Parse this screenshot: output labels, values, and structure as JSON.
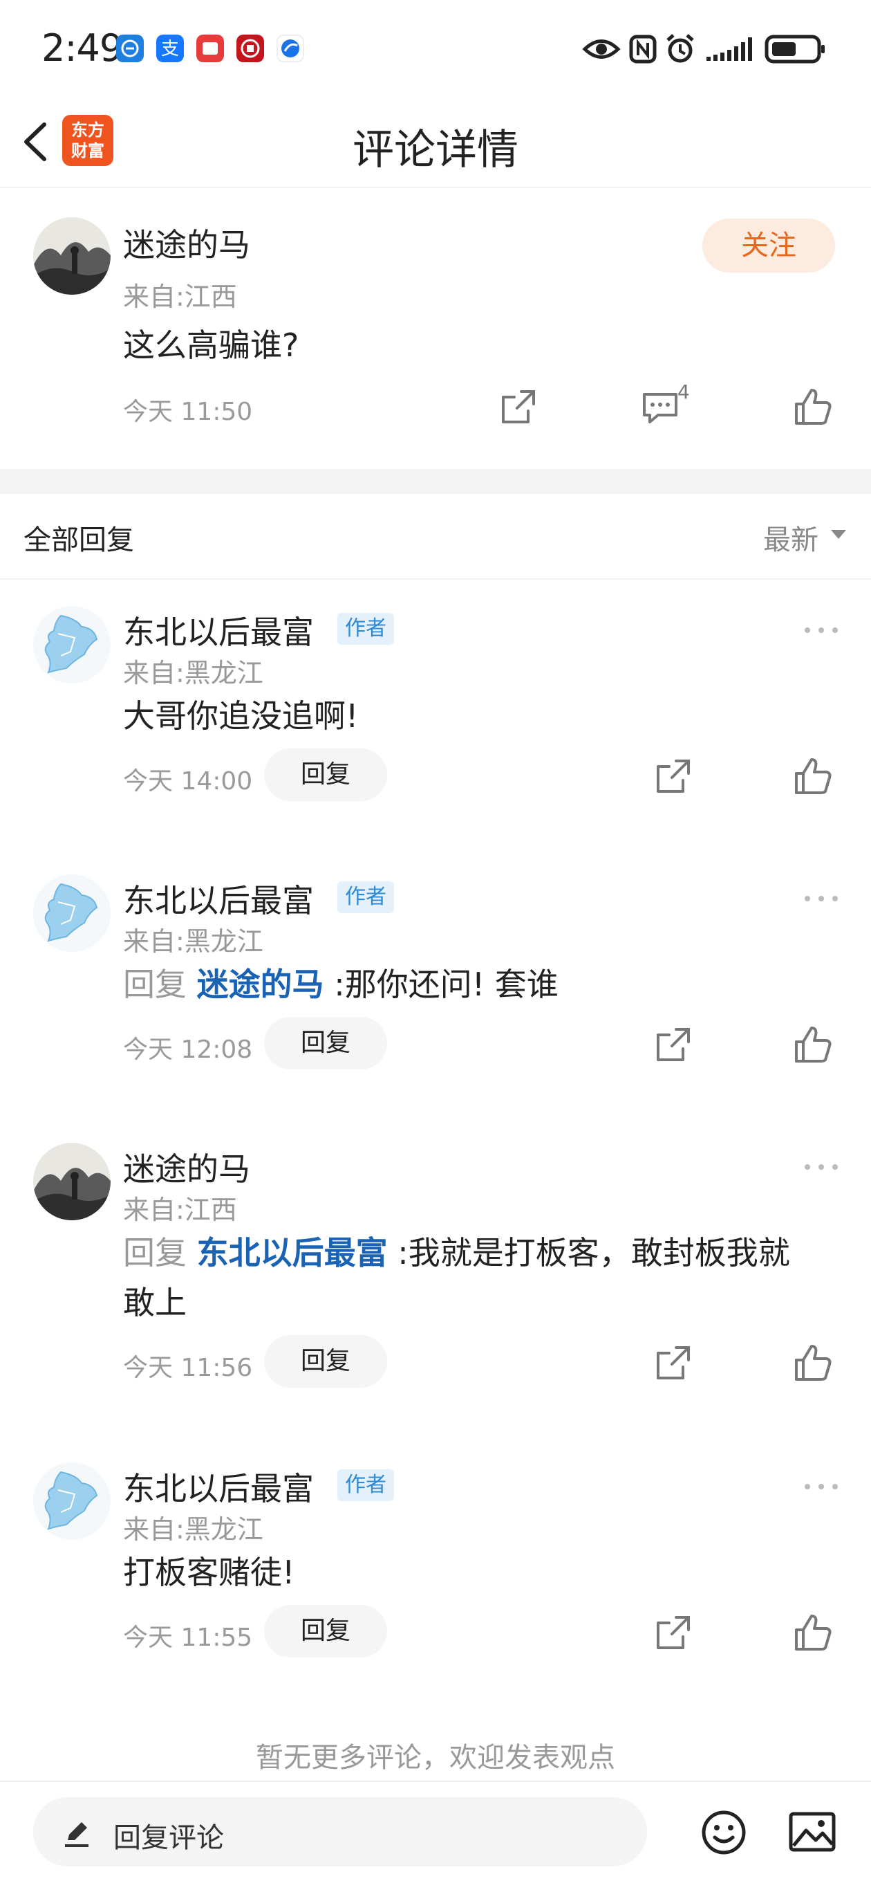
{
  "status_bar": {
    "time": "2:49",
    "app_icons": [
      {
        "name": "app-icon-1",
        "color": "#1e7fe0"
      },
      {
        "name": "alipay-icon",
        "color": "#1677ff"
      },
      {
        "name": "app-icon-3",
        "color": "#e83a3a"
      },
      {
        "name": "app-icon-4",
        "color": "#c4151c"
      },
      {
        "name": "app-icon-5",
        "color": "#1a73e8"
      }
    ]
  },
  "header": {
    "back_icon": "chevron-left-icon",
    "logo_line1": "东方",
    "logo_line2": "财富",
    "title": "评论详情"
  },
  "main_comment": {
    "name": "迷途的马",
    "location": "来自:江西",
    "content": "这么高骗谁?",
    "time": "今天 11:50",
    "follow_label": "关注",
    "comment_count": "4"
  },
  "replies_section": {
    "title": "全部回复",
    "sort_label": "最新"
  },
  "replies": [
    {
      "name": "东北以后最富",
      "badge": "作者",
      "location": "来自:黑龙江",
      "content": "大哥你追没追啊!",
      "time": "今天 14:00",
      "reply_label": "回复"
    },
    {
      "name": "东北以后最富",
      "badge": "作者",
      "location": "来自:黑龙江",
      "reply_prefix": "回复",
      "mention": "迷途的马",
      "content": ":那你还问!  套谁",
      "time": "今天 12:08",
      "reply_label": "回复"
    },
    {
      "name": "迷途的马",
      "location": "来自:江西",
      "reply_prefix": "回复",
      "mention": "东北以后最富",
      "content": ":我就是打板客，敢封板我就",
      "content_line2": "敢上",
      "time": "今天 11:56",
      "reply_label": "回复"
    },
    {
      "name": "东北以后最富",
      "badge": "作者",
      "location": "来自:黑龙江",
      "content": "打板客赌徒!",
      "time": "今天 11:55",
      "reply_label": "回复"
    }
  ],
  "footer_note": "暂无更多评论，欢迎发表观点",
  "bottom_bar": {
    "input_placeholder": "回复评论"
  },
  "colors": {
    "accent_orange": "#e9661d",
    "mention_blue": "#1a62b3",
    "badge_blue": "#2c8ad6"
  }
}
